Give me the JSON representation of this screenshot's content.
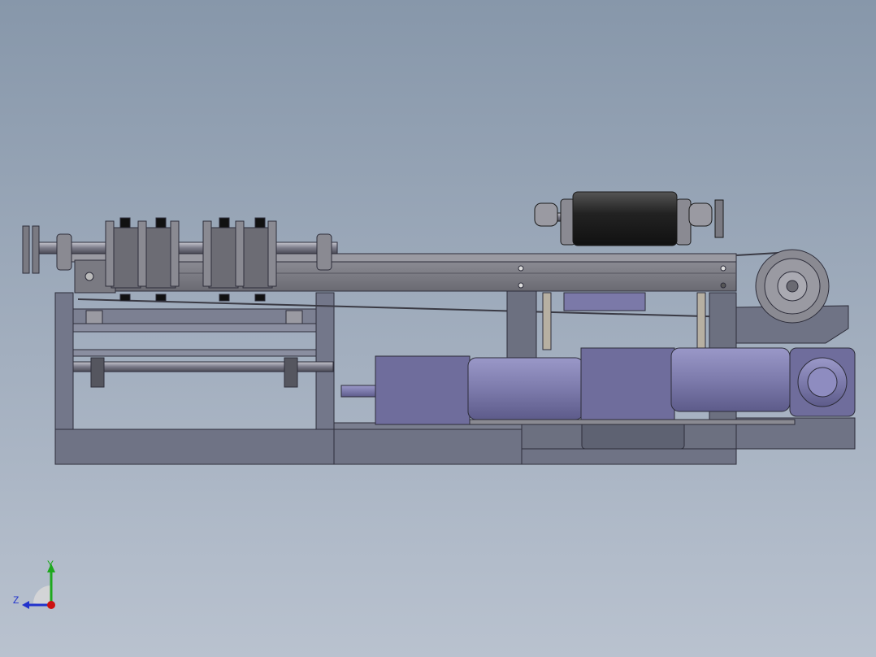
{
  "viewport": {
    "background_top": "#8797aa",
    "background_bottom": "#b9c2cf"
  },
  "model": {
    "frame_color": "#6f7385",
    "motor_color": "#7b79a8",
    "roller_color": "#2a2a2a",
    "sprocket_color": "#7a7a7a"
  },
  "triad": {
    "y_label": "Y",
    "z_label": "Z",
    "y_color": "#1ea81e",
    "z_color": "#2233cc",
    "x_color": "#cc1111"
  }
}
